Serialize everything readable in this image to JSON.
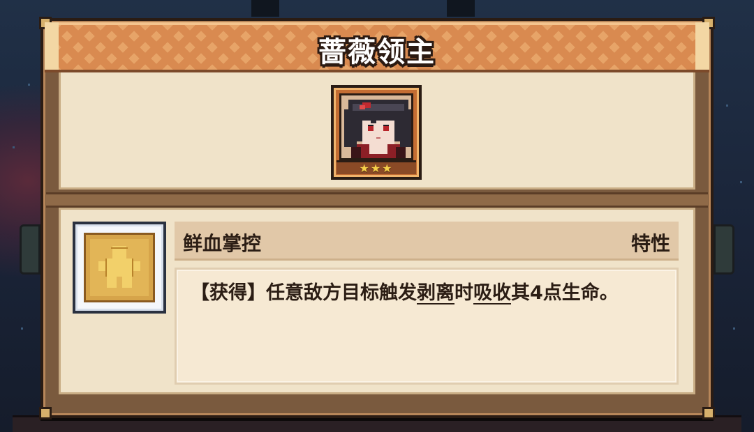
{
  "dialog": {
    "title": "蔷薇领主"
  },
  "unit": {
    "portrait_icon": "vampire-girl-portrait",
    "star_count": 3,
    "stars": "★★★"
  },
  "skill": {
    "icon": "golden-figure-emblem-icon",
    "name": "鲜血掌控",
    "type": "特性",
    "description_parts": {
      "prefix": "【获得】任意敌方目标触发",
      "keyword1": "剥离",
      "middle": "时",
      "keyword2": "吸收",
      "suffix": "其4点生命。"
    }
  },
  "colors": {
    "title_bar": "#e7a468",
    "panel_bg": "#f0e3c9",
    "frame_dark": "#2a1c14",
    "text": "#2b1d14"
  }
}
